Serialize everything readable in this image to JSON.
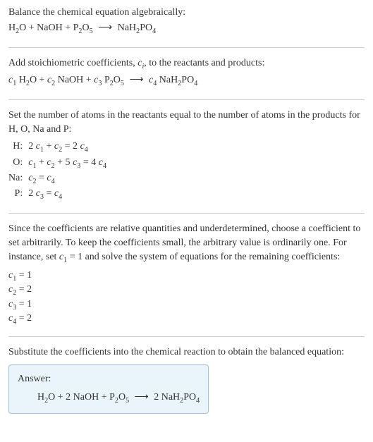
{
  "s1": {
    "intro": "Balance the chemical equation algebraically:",
    "eq_html": "H<sub>2</sub>O + NaOH + P<sub>2</sub>O<sub>5</sub> <span class='arrow'>⟶</span> NaH<sub>2</sub>PO<sub>4</sub>"
  },
  "s2": {
    "intro_html": "Add stoichiometric coefficients, <span class='ci'>c<sub>i</sub></span>, to the reactants and products:",
    "eq_html": "<span class='ci'>c</span><sub>1</sub> H<sub>2</sub>O + <span class='ci'>c</span><sub>2</sub> NaOH + <span class='ci'>c</span><sub>3</sub> P<sub>2</sub>O<sub>5</sub> <span class='arrow'>⟶</span> <span class='ci'>c</span><sub>4</sub> NaH<sub>2</sub>PO<sub>4</sub>"
  },
  "s3": {
    "intro": "Set the number of atoms in the reactants equal to the number of atoms in the products for H, O, Na and P:",
    "rows": [
      {
        "lbl": "H:",
        "expr_html": "2 <span class='ci'>c</span><sub>1</sub> + <span class='ci'>c</span><sub>2</sub> = 2 <span class='ci'>c</span><sub>4</sub>"
      },
      {
        "lbl": "O:",
        "expr_html": "<span class='ci'>c</span><sub>1</sub> + <span class='ci'>c</span><sub>2</sub> + 5 <span class='ci'>c</span><sub>3</sub> = 4 <span class='ci'>c</span><sub>4</sub>"
      },
      {
        "lbl": "Na:",
        "expr_html": "<span class='ci'>c</span><sub>2</sub> = <span class='ci'>c</span><sub>4</sub>"
      },
      {
        "lbl": "P:",
        "expr_html": "2 <span class='ci'>c</span><sub>3</sub> = <span class='ci'>c</span><sub>4</sub>"
      }
    ]
  },
  "s4": {
    "intro_html": "Since the coefficients are relative quantities and underdetermined, choose a coefficient to set arbitrarily. To keep the coefficients small, the arbitrary value is ordinarily one. For instance, set <span class='ci'>c</span><sub>1</sub> = 1 and solve the system of equations for the remaining coefficients:",
    "coefs": [
      "<span class='ci'>c</span><sub>1</sub> = 1",
      "<span class='ci'>c</span><sub>2</sub> = 2",
      "<span class='ci'>c</span><sub>3</sub> = 1",
      "<span class='ci'>c</span><sub>4</sub> = 2"
    ]
  },
  "s5": {
    "intro": "Substitute the coefficients into the chemical reaction to obtain the balanced equation:",
    "answer_label": "Answer:",
    "answer_eq_html": "H<sub>2</sub>O + 2 NaOH + P<sub>2</sub>O<sub>5</sub> <span class='arrow'>⟶</span> 2 NaH<sub>2</sub>PO<sub>4</sub>"
  }
}
